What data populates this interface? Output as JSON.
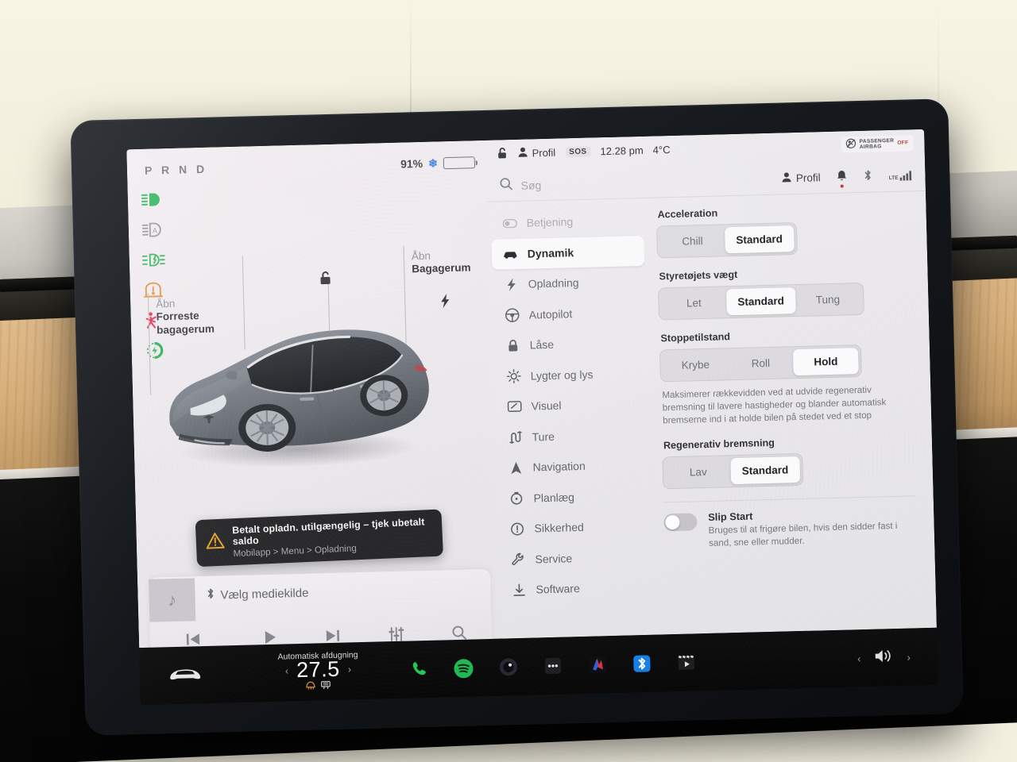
{
  "device": {
    "label": "tesla-model-3-center-touchscreen"
  },
  "drive_panel": {
    "gear_indicator": "P R N D",
    "battery": {
      "percent": "91%",
      "snowflake_icon": "snowflake-icon",
      "fill_ratio": 0.91
    },
    "telltales": [
      {
        "name": "high-beam-icon",
        "color": "#1fae4e"
      },
      {
        "name": "auto-high-beam-icon",
        "color": "#8d8e96"
      },
      {
        "name": "fog-light-icon",
        "color": "#1fae4e"
      },
      {
        "name": "tire-pressure-icon",
        "color": "#e08a34"
      },
      {
        "name": "seatbelt-warning-icon",
        "color": "#e0234a"
      },
      {
        "name": "regenerative-brake-icon",
        "color": "#1fae4e"
      }
    ],
    "callouts": {
      "frunk": {
        "line1": "Åbn",
        "line2": "Forreste",
        "line3": "bagagerum"
      },
      "trunk": {
        "line1": "Åbn",
        "line2": "Bagagerum"
      }
    },
    "lock_icon": "unlocked-padlock-icon",
    "charge_port_icon": "charge-bolt-icon",
    "alert": {
      "icon": "warning-triangle-icon",
      "title": "Betalt opladn. utilgængelig – tjek ubetalt saldo",
      "subtitle": "Mobilapp > Menu > Opladning"
    }
  },
  "media": {
    "album_art_icon": "music-note-icon",
    "source_icon": "bluetooth-icon",
    "title": "Vælg mediekilde",
    "controls": [
      {
        "name": "previous-track-button",
        "icon": "skip-back-icon"
      },
      {
        "name": "play-button",
        "icon": "play-icon"
      },
      {
        "name": "next-track-button",
        "icon": "skip-forward-icon"
      },
      {
        "name": "equalizer-button",
        "icon": "sliders-icon"
      },
      {
        "name": "media-search-button",
        "icon": "search-icon"
      }
    ],
    "page_dots": 3,
    "active_dot": 0
  },
  "statusbar": {
    "lock_icon": "unlocked-padlock-icon",
    "profile_icon": "person-icon",
    "profile_label": "Profil",
    "sos_label": "SOS",
    "time": "12.28 pm",
    "temperature": "4°C",
    "airbag": {
      "icon": "passenger-airbag-icon",
      "line1": "PASSENGER",
      "line2": "AIRBAG",
      "state": "OFF"
    }
  },
  "settings": {
    "search": {
      "icon": "search-icon",
      "placeholder": "Søg",
      "value": ""
    },
    "toolbar": {
      "profile_icon": "person-icon",
      "profile_label": "Profil",
      "bell_icon": "bell-icon",
      "bell_has_badge": true,
      "bluetooth_icon": "bluetooth-icon",
      "signal_icon": "signal-bars-icon",
      "signal_label": "LTE"
    },
    "nav": [
      {
        "label": "Betjening",
        "icon": "toggle-icon",
        "state": "header"
      },
      {
        "label": "Dynamik",
        "icon": "car-icon",
        "state": "active"
      },
      {
        "label": "Opladning",
        "icon": "bolt-icon",
        "state": "normal"
      },
      {
        "label": "Autopilot",
        "icon": "steering-wheel-icon",
        "state": "normal"
      },
      {
        "label": "Låse",
        "icon": "lock-icon",
        "state": "normal"
      },
      {
        "label": "Lygter og lys",
        "icon": "sun-icon",
        "state": "normal"
      },
      {
        "label": "Visuel",
        "icon": "display-icon",
        "state": "normal"
      },
      {
        "label": "Ture",
        "icon": "route-icon",
        "state": "normal"
      },
      {
        "label": "Navigation",
        "icon": "compass-arrow-icon",
        "state": "normal"
      },
      {
        "label": "Planlæg",
        "icon": "clock-icon",
        "state": "normal"
      },
      {
        "label": "Sikkerhed",
        "icon": "exclamation-circle-icon",
        "state": "normal"
      },
      {
        "label": "Service",
        "icon": "wrench-icon",
        "state": "normal"
      },
      {
        "label": "Software",
        "icon": "download-icon",
        "state": "normal"
      }
    ],
    "groups": [
      {
        "label": "Acceleration",
        "options": [
          "Chill",
          "Standard"
        ],
        "selected": "Standard"
      },
      {
        "label": "Styretøjets vægt",
        "options": [
          "Let",
          "Standard",
          "Tung"
        ],
        "selected": "Standard"
      },
      {
        "label": "Stoppetilstand",
        "options": [
          "Krybe",
          "Roll",
          "Hold"
        ],
        "selected": "Hold",
        "help": "Maksimerer rækkevidden ved at udvide regenerativ bremsning til lavere hastigheder og blander automatisk bremserne ind i at holde bilen på stedet ved et stop"
      },
      {
        "label": "Regenerativ bremsning",
        "options": [
          "Lav",
          "Standard"
        ],
        "selected": "Standard"
      }
    ],
    "toggle": {
      "name": "slip-start-toggle",
      "title": "Slip Start",
      "description": "Bruges til at frigøre bilen, hvis den sidder fast i sand, sne eller mudder.",
      "enabled": false
    }
  },
  "dock": {
    "car_icon": "car-front-icon",
    "climate": {
      "caption": "Automatisk afdugning",
      "temperature": "27.5",
      "left_arrow": "‹",
      "right_arrow": "›",
      "icons": [
        "front-defrost-icon",
        "rear-defrost-icon"
      ]
    },
    "apps": [
      {
        "name": "phone-app-icon",
        "label": "Telefon",
        "color": "#23c552"
      },
      {
        "name": "spotify-app-icon",
        "label": "Spotify",
        "color": "#1db954"
      },
      {
        "name": "camera-app-icon",
        "label": "Kamera",
        "color": "#2a2433"
      },
      {
        "name": "more-apps-icon",
        "label": "Mere",
        "color": "#1d1d20"
      },
      {
        "name": "tidal-app-icon",
        "label": "Tidal",
        "color": "#1e3fa8"
      },
      {
        "name": "bluetooth-app-icon",
        "label": "Bluetooth",
        "color": "#157fe3"
      },
      {
        "name": "theater-app-icon",
        "label": "Teater",
        "color": "#d8d8da"
      }
    ],
    "volume": {
      "icon": "speaker-icon",
      "left_arrow": "‹",
      "right_arrow": "›"
    }
  }
}
